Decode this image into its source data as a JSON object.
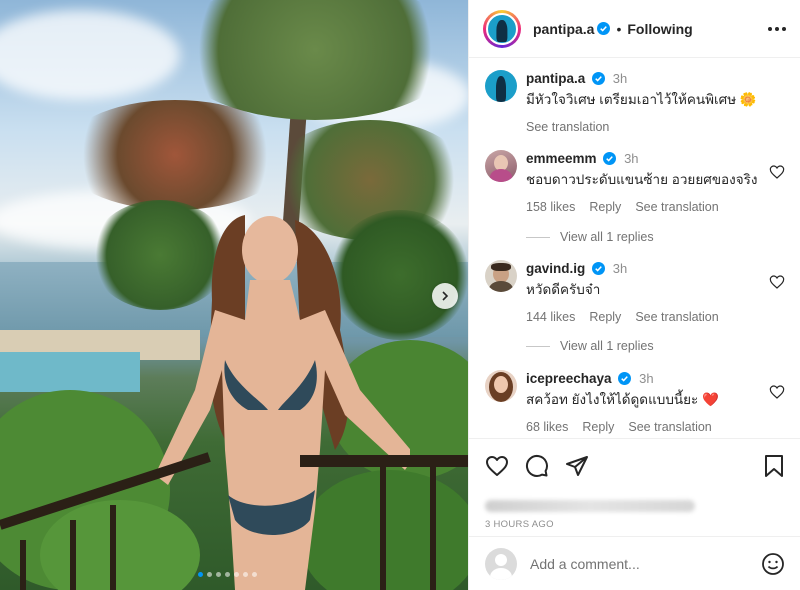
{
  "post": {
    "username": "pantipa.a",
    "follow_separator": "•",
    "follow_status": "Following"
  },
  "media": {
    "carousel_dots": 7,
    "active_dot": 0
  },
  "caption": {
    "username": "pantipa.a",
    "time": "3h",
    "text": "มีหัวใจวิเศษ เตรียมเอาไว้ให้คนพิเศษ 🌼",
    "see_translation": "See translation"
  },
  "comments": [
    {
      "username": "emmeemm",
      "time": "3h",
      "text": "ชอบดาวประดับแขนซ้าย อวยยศของจริง",
      "likes": "158 likes",
      "reply": "Reply",
      "see_translation": "See translation",
      "view_replies": "View all 1 replies"
    },
    {
      "username": "gavind.ig",
      "time": "3h",
      "text": "หวัดดีครับจ๋า",
      "likes": "144 likes",
      "reply": "Reply",
      "see_translation": "See translation",
      "view_replies": "View all 1 replies"
    },
    {
      "username": "icepreechaya",
      "time": "3h",
      "text": "สคว้อท ยังไงให้ได้ดูดแบบนี้ยะ ❤️",
      "likes": "68 likes",
      "reply": "Reply",
      "see_translation": "See translation"
    }
  ],
  "timestamp": "3 HOURS AGO",
  "add_comment": {
    "placeholder": "Add a comment..."
  },
  "colors": {
    "verified": "#0095f6",
    "text": "#262626",
    "secondary": "#737373",
    "heart_emoji": "#e0245e"
  }
}
